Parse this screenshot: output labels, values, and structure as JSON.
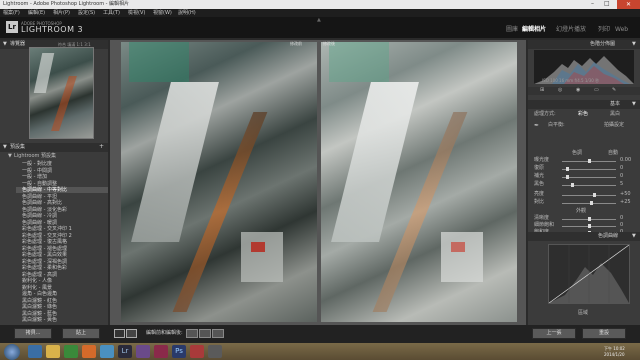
{
  "window": {
    "title": "Lightroom - Adobe Photoshop Lightroom - 編輯相片"
  },
  "menu": [
    "檔案(F)",
    "編輯(E)",
    "相片(P)",
    "設定(S)",
    "工具(T)",
    "檢視(V)",
    "視窗(W)",
    "說明(H)"
  ],
  "identity": {
    "logo": "Lr",
    "brand_small": "ADOBE PHOTOSHOP",
    "brand": "LIGHTROOM 3",
    "modules": [
      "圖庫",
      "編輯相片",
      "幻燈片播放",
      "列印",
      "Web"
    ],
    "active_module": "編輯相片"
  },
  "navigator": {
    "title": "導覽器",
    "zoom": "符合 填滿 1:1 3:1"
  },
  "presets": {
    "title": "預設集",
    "group": "Lightroom 預設集",
    "items": [
      "一般 - 對比度",
      "一般 - 中間調",
      "一般 - 增加",
      "一般 - 自動調整",
      "色調曲線 - 中等對比",
      "色調曲線 - 平坦",
      "色調曲線 - 高對比",
      "色調曲線 - 淡化色彩",
      "色調曲線 - 冷調",
      "色調曲線 - 暖調",
      "彩色處理 - 交叉沖印 1",
      "彩色處理 - 交叉沖印 2",
      "彩色處理 - 復古風格",
      "彩色處理 - 褪色處理",
      "彩色處理 - 黑白效果",
      "彩色處理 - 深褐色調",
      "彩色處理 - 柔和色彩",
      "彩色處理 - 高調",
      "銳利化 - 人像",
      "銳利化 - 風景",
      "邊角 - 白色邊角",
      "黑白濾鏡 - 紅色",
      "黑白濾鏡 - 綠色",
      "黑白濾鏡 - 藍色",
      "黑白濾鏡 - 黃色"
    ],
    "highlighted_index": 4
  },
  "left_buttons": {
    "copy": "拷貝...",
    "paste": "貼上"
  },
  "center": {
    "before_label": "修改前",
    "after_label": "修改後"
  },
  "toolbar": {
    "label": "編輯前和編輯後:"
  },
  "histogram": {
    "title": "色階分佈圖",
    "readout": "ISO 100   16 mm   f/4.5   1/30 秒"
  },
  "basic": {
    "title": "基本",
    "treatment_label": "處理方式:",
    "treatment_values": [
      "彩色",
      "黑白"
    ],
    "wb_label": "白平衡:",
    "wb_value": "拍攝設定",
    "tone_label": "色調",
    "auto": "自動",
    "sliders": [
      {
        "label": "曝光度",
        "value": "0.00",
        "pos": 0.5
      },
      {
        "label": "復原",
        "value": "0",
        "pos": 0.1
      },
      {
        "label": "補光",
        "value": "0",
        "pos": 0.1
      },
      {
        "label": "黑色",
        "value": "5",
        "pos": 0.2
      },
      {
        "label": "亮度",
        "value": "+50",
        "pos": 0.6
      },
      {
        "label": "對比",
        "value": "+25",
        "pos": 0.55
      }
    ],
    "presence_label": "外觀",
    "presence_sliders": [
      {
        "label": "清晰度",
        "value": "0",
        "pos": 0.5
      },
      {
        "label": "細節飽和",
        "value": "0",
        "pos": 0.5
      },
      {
        "label": "飽和度",
        "value": "0",
        "pos": 0.5
      }
    ]
  },
  "tone_curve": {
    "title": "色調曲線",
    "region": "區域"
  },
  "right_buttons": {
    "previous": "上一張",
    "reset": "重設"
  },
  "clock": {
    "time": "下午 10:02",
    "date": "2014/1/20"
  },
  "colors": {
    "panel": "#3b3b3b",
    "accent": "#ffffff",
    "inactive": "#8a8a8a"
  }
}
